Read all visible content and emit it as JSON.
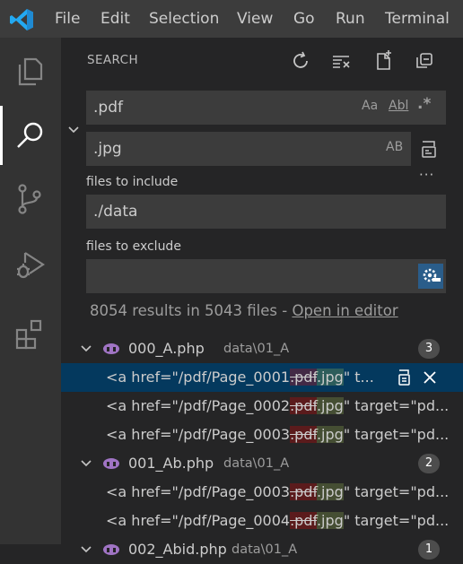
{
  "titlebar": {
    "menu": [
      "File",
      "Edit",
      "Selection",
      "View",
      "Go",
      "Run",
      "Terminal"
    ]
  },
  "activity": [
    "explorer-icon",
    "search-icon",
    "source-control-icon",
    "run-debug-icon",
    "extensions-icon"
  ],
  "search": {
    "title": "SEARCH",
    "query": ".pdf",
    "replace": ".jpg",
    "include_label": "files to include",
    "include_value": "./data",
    "exclude_label": "files to exclude",
    "exclude_value": "",
    "options": {
      "match_case": "Aa",
      "whole_word": "Abl",
      "regex": ".*",
      "preserve_case": "AB"
    },
    "more": "···",
    "summary_text": "8054 results in 5043 files - ",
    "open_in_editor": "Open in editor"
  },
  "results": {
    "files": [
      {
        "name": "000_A.php",
        "path": "data\\01_A",
        "count": "3",
        "matches": [
          {
            "pre": "<a href=\"/pdf/Page_0001",
            "old": ".pdf",
            "new": ".jpg",
            "post": "\" t..."
          },
          {
            "pre": "<a href=\"/pdf/Page_0002",
            "old": ".pdf",
            "new": ".jpg",
            "post": "\" target=\"pd..."
          },
          {
            "pre": "<a href=\"/pdf/Page_0003",
            "old": ".pdf",
            "new": ".jpg",
            "post": "\" target=\"pd..."
          }
        ]
      },
      {
        "name": "001_Ab.php",
        "path": "data\\01_A",
        "count": "2",
        "matches": [
          {
            "pre": "<a href=\"/pdf/Page_0003",
            "old": ".pdf",
            "new": ".jpg",
            "post": "\" target=\"pd..."
          },
          {
            "pre": "<a href=\"/pdf/Page_0004",
            "old": ".pdf",
            "new": ".jpg",
            "post": "\" target=\"pd..."
          }
        ]
      },
      {
        "name": "002_Abid.php",
        "path": "data\\01_A",
        "count": "1",
        "matches": []
      }
    ]
  },
  "colors": {
    "accent": "#007acc",
    "selection": "#04395e",
    "php": "#a074c4"
  }
}
